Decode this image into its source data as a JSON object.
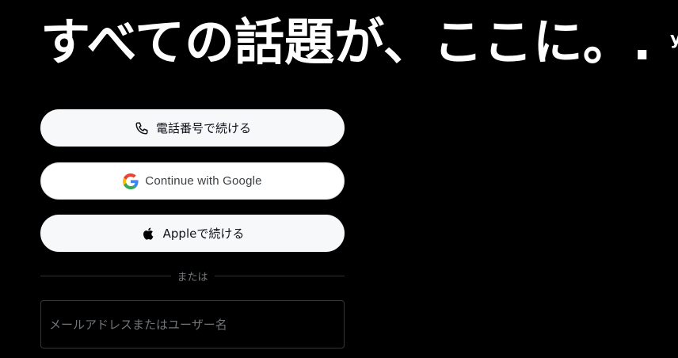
{
  "headline": "すべての話題が、ここに。.",
  "edge_glyph": "y",
  "buttons": {
    "phone": {
      "label": "電話番号で続ける",
      "icon": "phone-icon"
    },
    "google": {
      "label": "Continue with Google",
      "icon": "google-icon"
    },
    "apple": {
      "label": "Appleで続ける",
      "icon": "apple-icon"
    }
  },
  "divider_text": "または",
  "login_input": {
    "placeholder": "メールアドレスまたはユーザー名",
    "value": ""
  },
  "colors": {
    "background": "#000000",
    "button_bg": "#f7f8fa",
    "divider": "#2f3336",
    "muted_text": "#71767b",
    "google_blue": "#4285F4",
    "google_red": "#EA4335",
    "google_yellow": "#FBBC05",
    "google_green": "#34A853"
  }
}
